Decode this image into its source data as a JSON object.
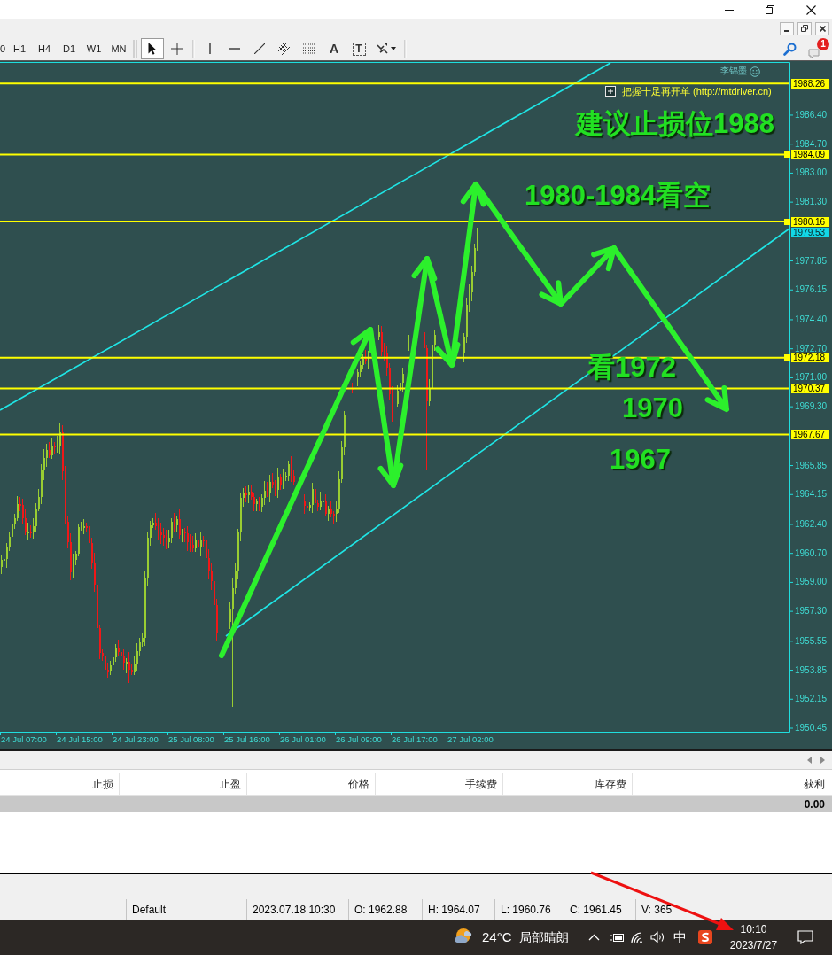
{
  "toolbar": {
    "timeframes": [
      {
        "label": "0",
        "selected": false
      },
      {
        "label": "H1",
        "selected": false
      },
      {
        "label": "H4",
        "selected": false
      },
      {
        "label": "D1",
        "selected": false
      },
      {
        "label": "W1",
        "selected": false
      },
      {
        "label": "MN",
        "selected": false
      }
    ],
    "pointer_tools": [
      {
        "kind": "cursor",
        "selected": true
      },
      {
        "kind": "crosshair",
        "selected": false
      }
    ],
    "drawing_tools": [
      {
        "kind": "vertical_line"
      },
      {
        "kind": "horizontal_line"
      },
      {
        "kind": "trendline"
      },
      {
        "kind": "channel"
      },
      {
        "kind": "fibonacci"
      },
      {
        "kind": "text",
        "label": "A"
      },
      {
        "kind": "text_label",
        "label": "T"
      },
      {
        "kind": "arrows"
      }
    ],
    "notifications": {
      "count": "1"
    }
  },
  "chart": {
    "corner_label": "李锦墨",
    "info_label": "把握十足再开单 (http://mtdriver.cn)",
    "annotations": [
      {
        "text": "建议止损位1988"
      },
      {
        "text": "1980-1984看空"
      },
      {
        "text": "看1972"
      },
      {
        "text": "1970"
      },
      {
        "text": "1967"
      }
    ],
    "level_lines": [
      {
        "label": "1988.26",
        "marker": false
      },
      {
        "label": "1984.09",
        "marker": true
      },
      {
        "label": "1980.16",
        "marker": true
      },
      {
        "label": "1972.18",
        "marker": true
      },
      {
        "label": "1970.37",
        "marker": false
      },
      {
        "label": "1967.67",
        "marker": false
      }
    ],
    "trend_label": "1979.53",
    "price_axis": [
      "1986.40",
      "1984.70",
      "1983.00",
      "1981.30",
      "1977.85",
      "1976.15",
      "1974.40",
      "1972.70",
      "1971.00",
      "1969.30",
      "1965.85",
      "1964.15",
      "1962.40",
      "1960.70",
      "1959.00",
      "1957.30",
      "1955.55",
      "1953.85",
      "1952.15",
      "1950.45"
    ],
    "time_axis": [
      "24 Jul 07:00",
      "24 Jul 15:00",
      "24 Jul 23:00",
      "25 Jul 08:00",
      "25 Jul 16:00",
      "26 Jul 01:00",
      "26 Jul 09:00",
      "26 Jul 17:00",
      "27 Jul 02:00"
    ]
  },
  "terminal": {
    "columns": [
      "止损",
      "止盈",
      "价格",
      "手续费",
      "库存费",
      "获利"
    ],
    "total": "0.00"
  },
  "status_bar": [
    "Default",
    "2023.07.18 10:30",
    "O: 1962.88",
    "H: 1964.07",
    "L: 1960.76",
    "C: 1961.45",
    "V: 365"
  ],
  "taskbar": {
    "temperature": "24°C",
    "weather": "局部晴朗",
    "input_method": "中",
    "time": "10:10",
    "date": "2023/7/27"
  }
}
